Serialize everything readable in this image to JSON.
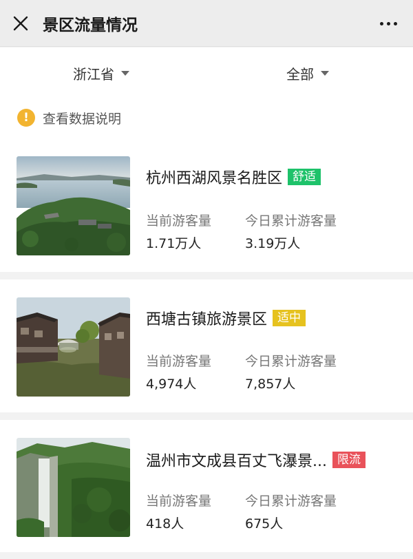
{
  "header": {
    "title": "景区流量情况"
  },
  "filters": {
    "province": "浙江省",
    "scope": "全部"
  },
  "notice": {
    "text": "查看数据说明"
  },
  "labels": {
    "current": "当前游客量",
    "today": "今日累计游客量"
  },
  "spots": [
    {
      "name": "杭州西湖风景名胜区",
      "status": "舒适",
      "status_color": "#1ec26a",
      "current": "1.71万人",
      "today": "3.19万人"
    },
    {
      "name": "西塘古镇旅游景区",
      "status": "适中",
      "status_color": "#e6c21f",
      "current": "4,974人",
      "today": "7,857人"
    },
    {
      "name": "温州市文成县百丈飞瀑景...",
      "status": "限流",
      "status_color": "#e9525a",
      "current": "418人",
      "today": "675人"
    }
  ]
}
